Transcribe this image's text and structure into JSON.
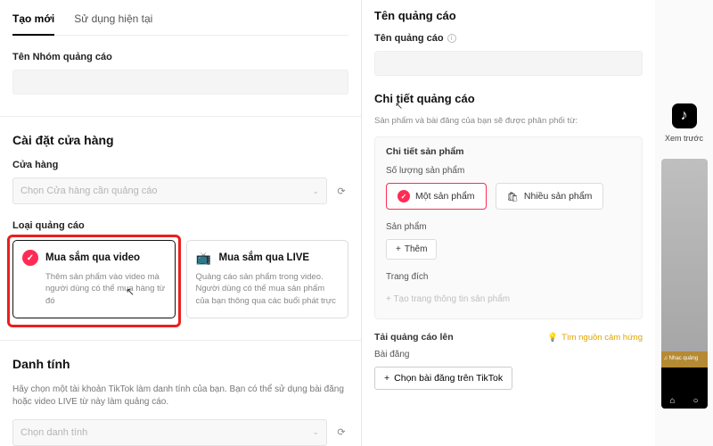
{
  "left": {
    "tabs": {
      "create": "Tạo mới",
      "existing": "Sử dụng hiện tại"
    },
    "group_name_label": "Tên Nhóm quảng cáo",
    "shop_settings_title": "Cài đặt cửa hàng",
    "shop_label": "Cửa hàng",
    "shop_placeholder": "Chọn Cửa hàng cần quảng cáo",
    "ad_type_label": "Loại quảng cáo",
    "opt1": {
      "title": "Mua sắm qua video",
      "desc": "Thêm sản phẩm vào video mà người dùng có thể mua hàng từ đó"
    },
    "opt2": {
      "title": "Mua sắm qua LIVE",
      "desc": "Quảng cáo sản phẩm trong video. Người dùng có thể mua sản phẩm của bạn thông qua các buổi phát trực"
    },
    "identity_title": "Danh tính",
    "identity_desc": "Hãy chọn một tài khoản TikTok làm danh tính của bạn. Bạn có thể sử dụng bài đăng hoặc video LIVE từ này làm quảng cáo.",
    "identity_placeholder": "Chọn danh tính"
  },
  "right": {
    "ad_name_title": "Tên quảng cáo",
    "ad_name_label": "Tên quảng cáo",
    "ad_details_title": "Chi tiết quảng cáo",
    "ad_details_sub": "Sản phẩm và bài đăng của bạn sẽ được phân phối từ:",
    "product_details_header": "Chi tiết sản phẩm",
    "product_qty_label": "Số lượng sản phẩm",
    "chip_single": "Một sản phẩm",
    "chip_multi": "Nhiều sản phẩm",
    "product_label": "Sản phẩm",
    "add_btn": "Thêm",
    "landing_label": "Trang đích",
    "landing_disabled": "Tạo trang thông tin sản phẩm",
    "upload_label": "Tải quảng cáo lên",
    "inspo": "Tìm nguồn cảm hứng",
    "post_label": "Bài đăng",
    "choose_post_btn": "Chọn bài đăng trên TikTok"
  },
  "preview": {
    "label": "Xem trước",
    "audio": "♫ Nhạc quảng"
  }
}
